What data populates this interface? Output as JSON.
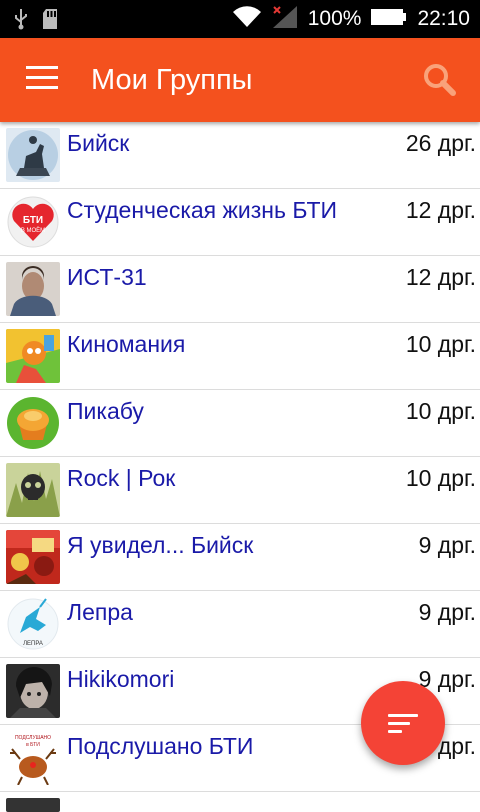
{
  "status_bar": {
    "battery": "100%",
    "time": "22:10",
    "icons": [
      "usb-icon",
      "sd-card-icon",
      "wifi-icon",
      "no-signal-icon",
      "battery-icon"
    ]
  },
  "app_bar": {
    "title": "Мои Группы",
    "icons": [
      "menu-icon",
      "search-icon"
    ],
    "color": "#f4511e"
  },
  "groups": [
    {
      "name": "Бийск",
      "count": "26 дрг.",
      "avatar": "monument-avatar"
    },
    {
      "name": "Студенческая жизнь БТИ",
      "count": "12 дрг.",
      "avatar": "bti-heart-avatar",
      "avatar_text_1": "БТИ",
      "avatar_text_2": "В МОЁМ"
    },
    {
      "name": "ИСТ-31",
      "count": "12 дрг.",
      "avatar": "person-photo-avatar"
    },
    {
      "name": "Киномания",
      "count": "10 дрг.",
      "avatar": "cartoon-avatar"
    },
    {
      "name": "Пикабу",
      "count": "10 дрг.",
      "avatar": "cupcake-avatar"
    },
    {
      "name": "Rock | Рок",
      "count": "10 дрг.",
      "avatar": "skull-avatar"
    },
    {
      "name": "Я увидел... Бийск",
      "count": "9 дрг.",
      "avatar": "collage-avatar"
    },
    {
      "name": "Лепра",
      "count": "9 дрг.",
      "avatar": "unicorn-avatar",
      "avatar_text": "ЛЕПРА"
    },
    {
      "name": "Hikikomori",
      "count": "9 дрг.",
      "avatar": "face-photo-avatar"
    },
    {
      "name": "Подслушано БТИ",
      "count": "дрг.",
      "avatar": "reindeer-avatar",
      "avatar_text_1": "ПОДСЛУШАНО",
      "avatar_text_2": "в БТИ"
    }
  ],
  "fab": {
    "icon": "sort-icon",
    "color": "#f44336"
  },
  "colors": {
    "link": "#1a1aa8",
    "divider": "#dcdcdc"
  }
}
